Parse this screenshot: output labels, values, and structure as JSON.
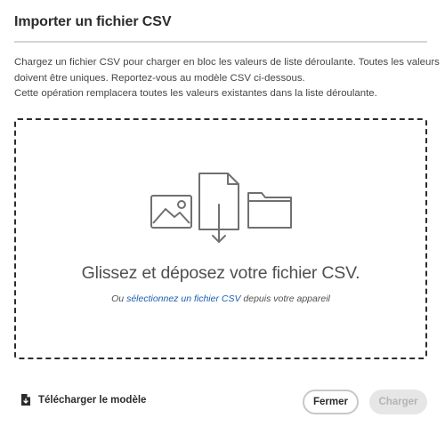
{
  "dialog": {
    "title": "Importer un fichier CSV",
    "description_lines": [
      "Chargez un fichier CSV pour charger en bloc les valeurs de liste déroulante. Toutes les valeurs",
      "doivent être uniques. Reportez-vous au modèle CSV ci-dessous.",
      "Cette opération remplacera toutes les valeurs existantes dans la liste déroulante."
    ],
    "dropzone": {
      "heading": "Glissez et déposez votre fichier CSV.",
      "sub_prefix": "Ou ",
      "sub_link": "sélectionnez un fichier CSV",
      "sub_suffix": " depuis votre appareil"
    },
    "footer": {
      "download_template_label": "Télécharger le modèle",
      "close_label": "Fermer",
      "upload_label": "Charger"
    },
    "colors": {
      "link": "#1a5fb4",
      "illustration_stroke": "#707070",
      "dropzone_border": "#2c2c2c"
    },
    "icons": [
      "image-icon",
      "file-download-icon",
      "folder-icon",
      "document-download-icon"
    ]
  }
}
